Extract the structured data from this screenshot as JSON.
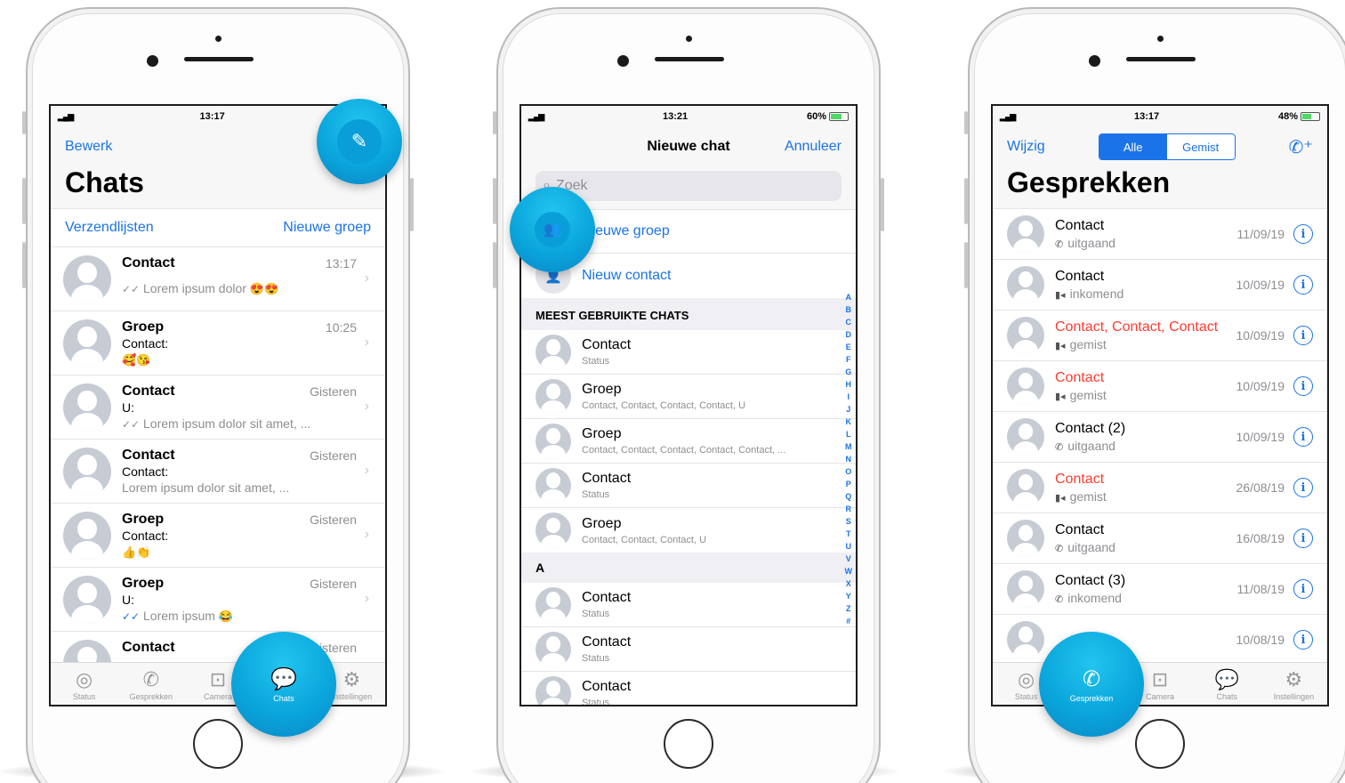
{
  "screens": {
    "chats": {
      "status": {
        "signal": "▂▄▆",
        "time": "13:17"
      },
      "edit_label": "Bewerk",
      "title": "Chats",
      "broadcast_label": "Verzendlijsten",
      "new_group_label": "Nieuwe groep",
      "rows": [
        {
          "name": "Contact",
          "time": "13:17",
          "tick": "✓✓",
          "msg": "Lorem ipsum dolor",
          "emoji": "😍😍"
        },
        {
          "name": "Groep",
          "time": "10:25",
          "who": "Contact:",
          "emoji": "🥰😘"
        },
        {
          "name": "Contact",
          "time": "Gisteren",
          "who": "U:",
          "tick": "✓✓",
          "msg": "Lorem ipsum dolor sit amet, ..."
        },
        {
          "name": "Contact",
          "time": "Gisteren",
          "who": "Contact:",
          "msg": "Lorem ipsum dolor sit amet, ..."
        },
        {
          "name": "Groep",
          "time": "Gisteren",
          "who": "Contact:",
          "emoji": "👍👏"
        },
        {
          "name": "Groep",
          "time": "Gisteren",
          "who": "U:",
          "tick": "✓✓",
          "msg": "Lorem ipsum",
          "emoji": "😂"
        },
        {
          "name": "Contact",
          "time": "Gisteren"
        }
      ],
      "tabs": [
        {
          "label": "Status",
          "icon": "◎"
        },
        {
          "label": "Gesprekken",
          "icon": "✆"
        },
        {
          "label": "Camera",
          "icon": "⊡"
        },
        {
          "label": "Chats",
          "icon": "💬"
        },
        {
          "label": "Instellingen",
          "icon": "⚙"
        }
      ]
    },
    "new_chat": {
      "status": {
        "signal": "▂▄▆",
        "time": "13:21",
        "battery": "60%"
      },
      "title": "Nieuwe chat",
      "cancel_label": "Annuleer",
      "search_placeholder": "Zoek",
      "new_group_label": "Nieuwe groep",
      "new_contact_label": "Nieuw contact",
      "section_frequent": "MEEST GEBRUIKTE CHATS",
      "frequent": [
        {
          "name": "Contact",
          "status": "Status"
        },
        {
          "name": "Groep",
          "status": "Contact, Contact, Contact, Contact, U"
        },
        {
          "name": "Groep",
          "status": "Contact, Contact, Contact, Contact, Contact, ..."
        },
        {
          "name": "Contact",
          "status": "Status"
        },
        {
          "name": "Groep",
          "status": "Contact, Contact, Contact, U"
        }
      ],
      "section_a": "A",
      "contacts_a": [
        {
          "name": "Contact",
          "status": "Status"
        },
        {
          "name": "Contact",
          "status": "Status"
        },
        {
          "name": "Contact",
          "status": "Status"
        }
      ],
      "alphabet": [
        "A",
        "B",
        "C",
        "D",
        "E",
        "F",
        "G",
        "H",
        "I",
        "J",
        "K",
        "L",
        "M",
        "N",
        "O",
        "P",
        "Q",
        "R",
        "S",
        "T",
        "U",
        "V",
        "W",
        "X",
        "Y",
        "Z",
        "#"
      ]
    },
    "calls": {
      "status": {
        "signal": "▂▄▆",
        "time": "13:17",
        "battery": "48%"
      },
      "edit_label": "Wijzig",
      "seg_all": "Alle",
      "seg_missed": "Gemist",
      "title": "Gesprekken",
      "rows": [
        {
          "name": "Contact",
          "type": "uitgaand",
          "icon": "✆",
          "date": "11/09/19",
          "missed": false
        },
        {
          "name": "Contact",
          "type": "inkomend",
          "icon": "▮◂",
          "date": "10/09/19",
          "missed": false
        },
        {
          "name": "Contact, Contact, Contact",
          "type": "gemist",
          "icon": "▮◂",
          "date": "10/09/19",
          "missed": true
        },
        {
          "name": "Contact",
          "type": "gemist",
          "icon": "▮◂",
          "date": "10/09/19",
          "missed": true
        },
        {
          "name": "Contact (2)",
          "type": "uitgaand",
          "icon": "✆",
          "date": "10/09/19",
          "missed": false
        },
        {
          "name": "Contact",
          "type": "gemist",
          "icon": "▮◂",
          "date": "26/08/19",
          "missed": true
        },
        {
          "name": "Contact",
          "type": "uitgaand",
          "icon": "✆",
          "date": "16/08/19",
          "missed": false
        },
        {
          "name": "Contact (3)",
          "type": "inkomend",
          "icon": "✆",
          "date": "11/08/19",
          "missed": false
        },
        {
          "name": "",
          "type": "",
          "icon": "",
          "date": "10/08/19",
          "missed": false
        }
      ],
      "tabs": [
        {
          "label": "Status",
          "icon": "◎"
        },
        {
          "label": "Gesprekken",
          "icon": "✆"
        },
        {
          "label": "Camera",
          "icon": "⊡"
        },
        {
          "label": "Chats",
          "icon": "💬"
        },
        {
          "label": "Instellingen",
          "icon": "⚙"
        }
      ]
    }
  },
  "colors": {
    "accent": "#1a73e8",
    "missed": "#ff3b30",
    "highlight": "#0aa6dc"
  }
}
